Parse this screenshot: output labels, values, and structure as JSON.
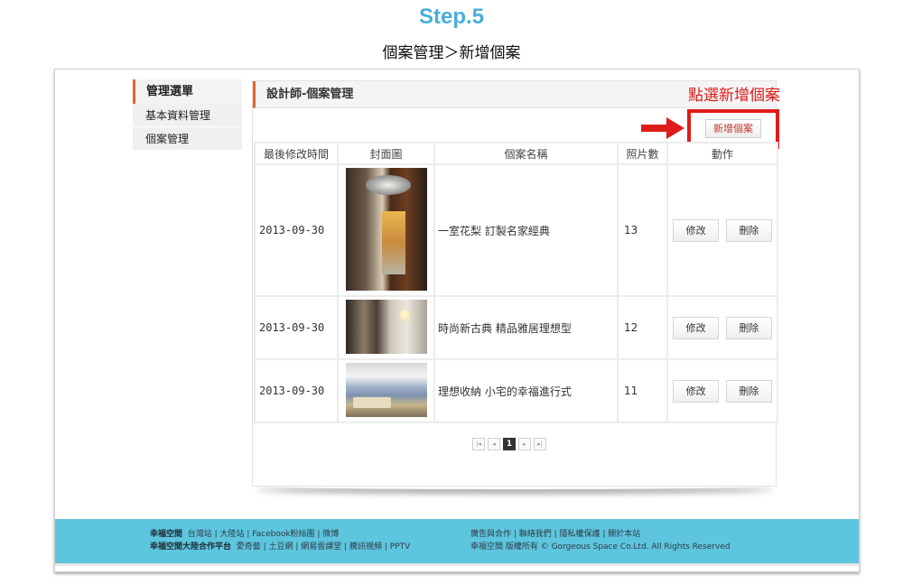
{
  "header": {
    "step": "Step.5",
    "subtitle": "個案管理＞新增個案"
  },
  "sidebar": {
    "title": "管理選單",
    "items": [
      {
        "label": "基本資料管理"
      },
      {
        "label": "個案管理"
      }
    ]
  },
  "panel": {
    "title": "設計師-個案管理",
    "add_button": "新增個案",
    "annotation": "點選新增個案",
    "columns": [
      "最後修改時間",
      "封面圖",
      "個案名稱",
      "照片數",
      "動作"
    ],
    "rows": [
      {
        "date": "2013-09-30",
        "name": "一室花梨 訂製名家經典",
        "count": "13"
      },
      {
        "date": "2013-09-30",
        "name": "時尚新古典 精品雅居理想型",
        "count": "12"
      },
      {
        "date": "2013-09-30",
        "name": "理想收納 小宅的幸福進行式",
        "count": "11"
      }
    ],
    "edit_label": "修改",
    "delete_label": "刪除"
  },
  "pager": {
    "first": "|◂",
    "prev": "◂",
    "current": "1",
    "next": "▸",
    "last": "▸|"
  },
  "footer": {
    "left_line1_brand": "幸福空間",
    "left_line1_links": "台灣站 | 大陸站 | Facebook粉絲團 | 微博",
    "left_line2_brand": "幸福空間大陸合作平台",
    "left_line2_links": "愛奇藝 | 土豆網 | 網易雲課堂 | 騰訊視頻 | PPTV",
    "right_line1": "廣告與合作 | 聯絡我們 | 隱私權保護 | 關於本站",
    "right_line2": "幸福空間  版權所有 © Gorgeous Space Co.Ltd. All Rights Reserved"
  },
  "colors": {
    "accent": "#e8632b",
    "annotation": "#e01b1b",
    "footer": "#5ec5de",
    "step": "#4aaed8"
  }
}
